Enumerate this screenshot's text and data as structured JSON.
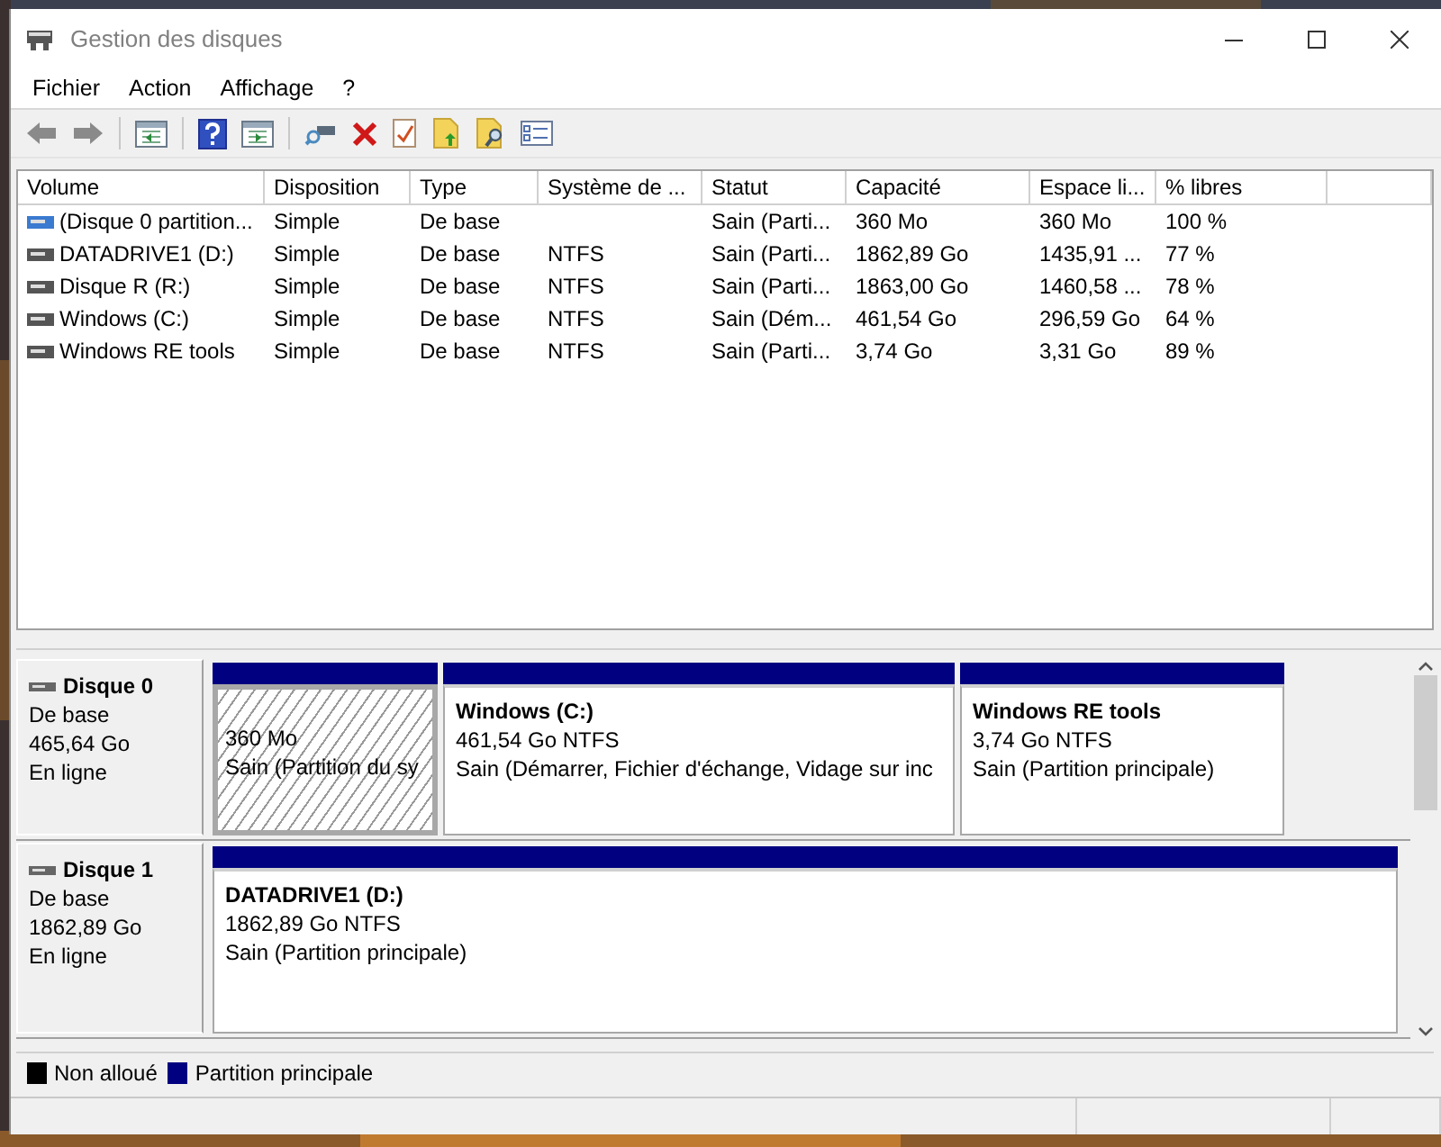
{
  "window": {
    "title": "Gestion des disques"
  },
  "menu": [
    "Fichier",
    "Action",
    "Affichage",
    "?"
  ],
  "table": {
    "columns": [
      "Volume",
      "Disposition",
      "Type",
      "Système de ...",
      "Statut",
      "Capacité",
      "Espace li...",
      "% libres"
    ],
    "rows": [
      {
        "kind": "system",
        "cells": [
          "(Disque 0 partition...",
          "Simple",
          "De base",
          "",
          "Sain (Parti...",
          "360 Mo",
          "360 Mo",
          "100 %"
        ]
      },
      {
        "kind": "data",
        "cells": [
          "DATADRIVE1 (D:)",
          "Simple",
          "De base",
          "NTFS",
          "Sain (Parti...",
          "1862,89 Go",
          "1435,91 ...",
          "77 %"
        ]
      },
      {
        "kind": "data",
        "cells": [
          "Disque R (R:)",
          "Simple",
          "De base",
          "NTFS",
          "Sain (Parti...",
          "1863,00 Go",
          "1460,58 ...",
          "78 %"
        ]
      },
      {
        "kind": "data",
        "cells": [
          "Windows (C:)",
          "Simple",
          "De base",
          "NTFS",
          "Sain (Dém...",
          "461,54 Go",
          "296,59 Go",
          "64 %"
        ]
      },
      {
        "kind": "data",
        "cells": [
          "Windows RE tools",
          "Simple",
          "De base",
          "NTFS",
          "Sain (Parti...",
          "3,74 Go",
          "3,31 Go",
          "89 %"
        ]
      }
    ]
  },
  "disks": [
    {
      "name": "Disque 0",
      "type": "De base",
      "size": "465,64 Go",
      "status": "En ligne",
      "partitions": [
        {
          "kind": "primary",
          "selected": true,
          "size": "360 Mo",
          "status": "Sain (Partition du sy"
        },
        {
          "kind": "primary",
          "selected": false,
          "name": "Windows  (C:)",
          "size": "461,54 Go NTFS",
          "status": "Sain (Démarrer, Fichier d'échange, Vidage sur inc"
        },
        {
          "kind": "primary",
          "selected": false,
          "name": "Windows RE tools",
          "size": "3,74 Go NTFS",
          "status": "Sain (Partition principale)"
        }
      ]
    },
    {
      "name": "Disque 1",
      "type": "De base",
      "size": "1862,89 Go",
      "status": "En ligne",
      "partitions": [
        {
          "kind": "primary",
          "selected": false,
          "name": "DATADRIVE1  (D:)",
          "size": "1862,89 Go NTFS",
          "status": "Sain (Partition principale)"
        }
      ]
    }
  ],
  "legend": [
    {
      "label": "Non alloué",
      "color": "#000000"
    },
    {
      "label": "Partition principale",
      "color": "#000080"
    }
  ]
}
